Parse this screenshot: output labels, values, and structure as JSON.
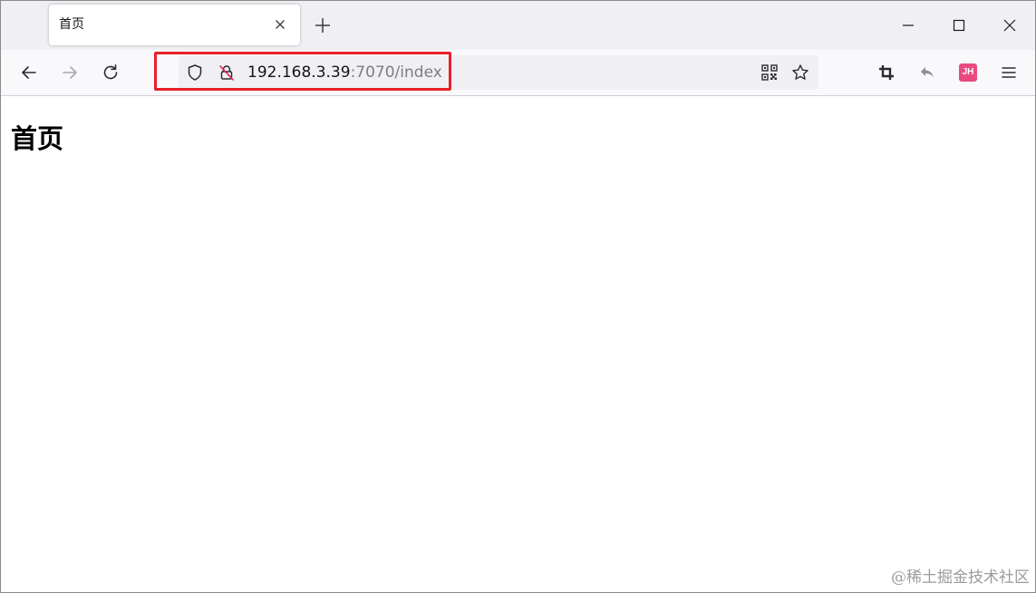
{
  "tab": {
    "title": "首页",
    "close_icon": "close-icon"
  },
  "toolbar": {
    "new_tab_icon": "plus-icon",
    "window_controls": [
      "minimize-icon",
      "maximize-icon",
      "close-icon"
    ],
    "nav_icons": [
      "back-arrow-icon",
      "forward-arrow-icon",
      "reload-icon"
    ]
  },
  "urlbar": {
    "host": "192.168.3.39",
    "rest": ":7070/index",
    "left_icons": [
      "shield-icon",
      "insecure-lock-icon"
    ],
    "right_icons": [
      "qr-code-icon",
      "bookmark-star-icon"
    ],
    "highlight_color": "#e8202a"
  },
  "extensions": {
    "icons": [
      "crop-icon",
      "undo-arrow-icon",
      "avatar-badge",
      "hamburger-menu-icon"
    ],
    "avatar_text": "JH",
    "avatar_color": "#e84b7e"
  },
  "page": {
    "heading": "首页"
  },
  "watermark": {
    "text": "@稀土掘金技术社区"
  }
}
